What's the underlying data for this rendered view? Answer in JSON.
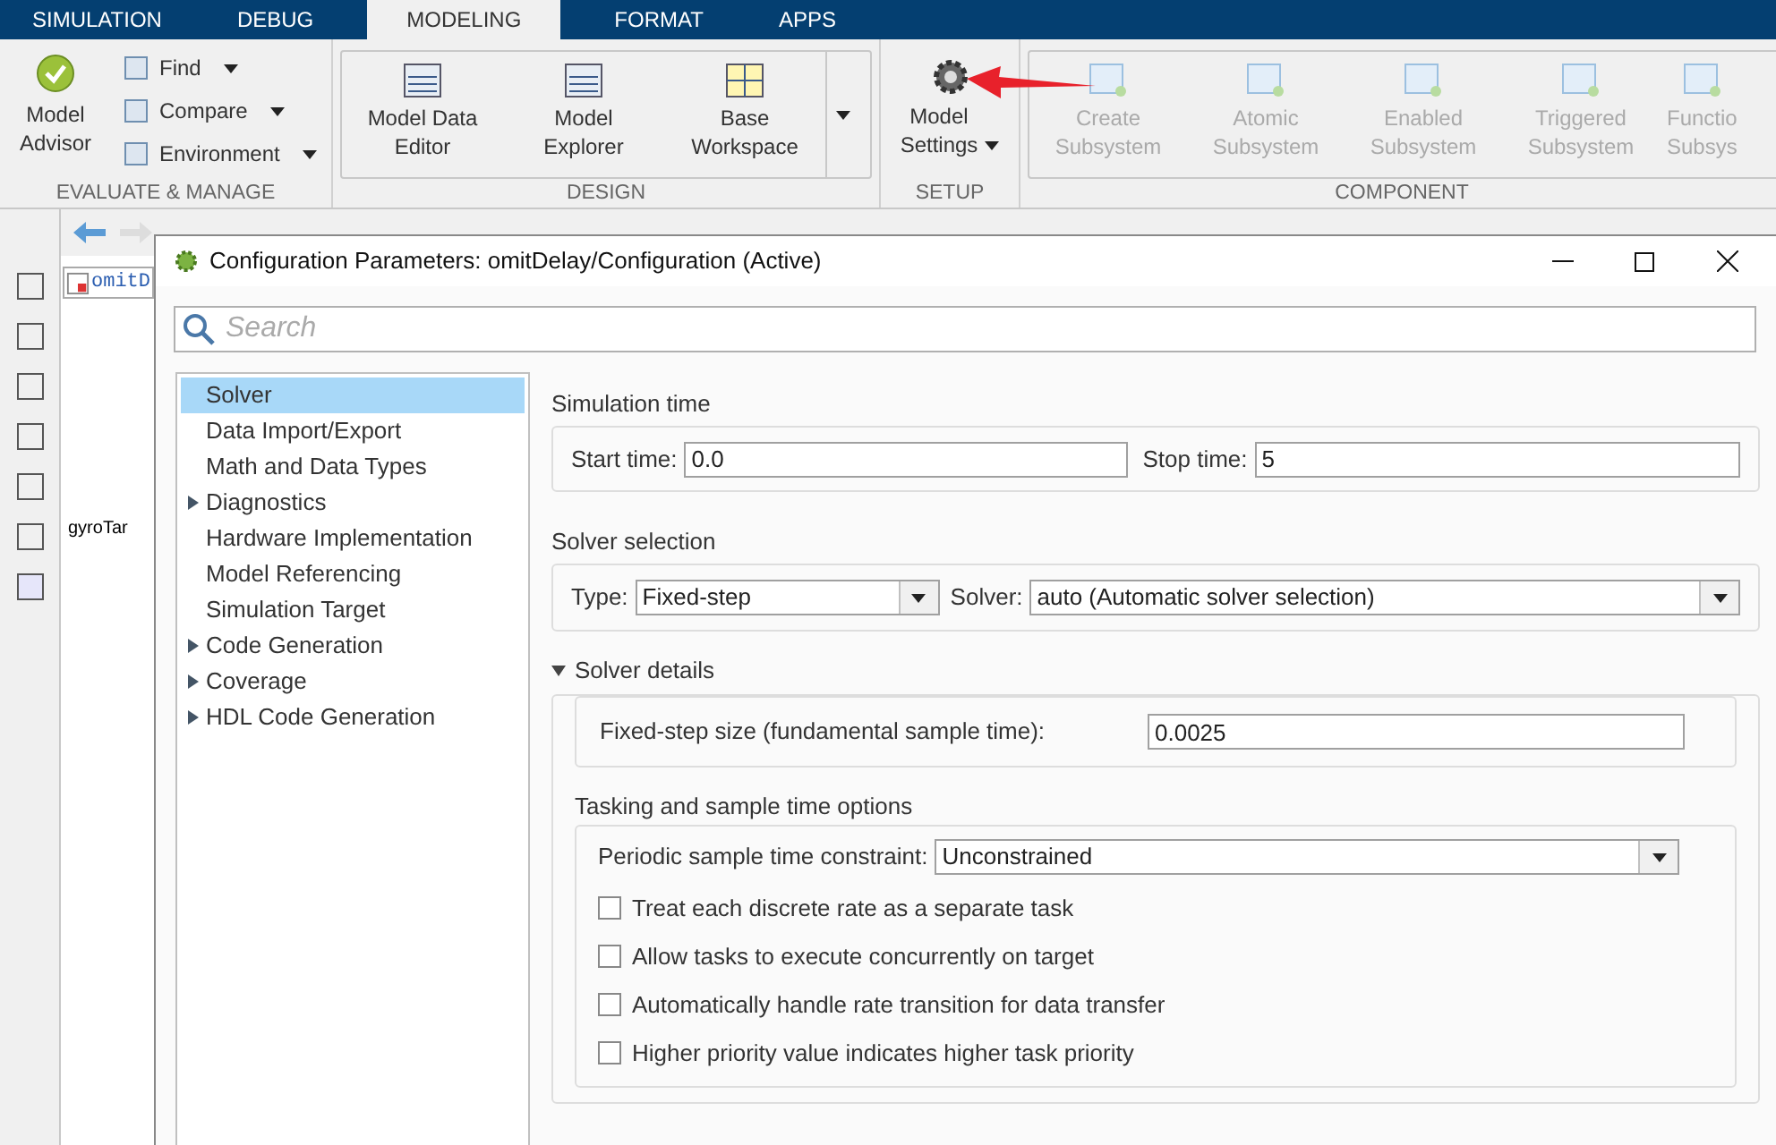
{
  "ribbon_tabs": [
    {
      "label": "SIMULATION",
      "selected": false
    },
    {
      "label": "DEBUG",
      "selected": false
    },
    {
      "label": "MODELING",
      "selected": true
    },
    {
      "label": "FORMAT",
      "selected": false
    },
    {
      "label": "APPS",
      "selected": false
    }
  ],
  "evaluate_group": {
    "label": "EVALUATE & MANAGE",
    "advisor": "Model\nAdvisor",
    "small_buttons": [
      "Find",
      "Compare",
      "Environment"
    ]
  },
  "design_group": {
    "label": "DESIGN",
    "buttons": [
      "Model Data\nEditor",
      "Model\nExplorer",
      "Base\nWorkspace"
    ]
  },
  "setup_group": {
    "label": "SETUP",
    "button": "Model\nSettings"
  },
  "component_group": {
    "label": "COMPONENT",
    "buttons": [
      {
        "label": "Create\nSubsystem",
        "disabled": true
      },
      {
        "label": "Atomic\nSubsystem",
        "disabled": true
      },
      {
        "label": "Enabled\nSubsystem",
        "disabled": true
      },
      {
        "label": "Triggered\nSubsystem",
        "disabled": true
      },
      {
        "label": "Functio\nSubsys",
        "disabled": true
      }
    ]
  },
  "editor": {
    "breadcrumb": "omitD",
    "signal_label": "gyroTar"
  },
  "dialog": {
    "title": "Configuration Parameters: omitDelay/Configuration (Active)",
    "search": {
      "placeholder": "Search"
    },
    "tree": [
      {
        "label": "Solver",
        "selected": true,
        "expandable": false
      },
      {
        "label": "Data Import/Export",
        "selected": false,
        "expandable": false
      },
      {
        "label": "Math and Data Types",
        "selected": false,
        "expandable": false
      },
      {
        "label": "Diagnostics",
        "selected": false,
        "expandable": true
      },
      {
        "label": "Hardware Implementation",
        "selected": false,
        "expandable": false
      },
      {
        "label": "Model Referencing",
        "selected": false,
        "expandable": false
      },
      {
        "label": "Simulation Target",
        "selected": false,
        "expandable": false
      },
      {
        "label": "Code Generation",
        "selected": false,
        "expandable": true
      },
      {
        "label": "Coverage",
        "selected": false,
        "expandable": true
      },
      {
        "label": "HDL Code Generation",
        "selected": false,
        "expandable": true
      }
    ],
    "simulation_time": {
      "heading": "Simulation time",
      "start_label": "Start time:",
      "start_value": "0.0",
      "stop_label": "Stop time:",
      "stop_value": "5"
    },
    "solver_selection": {
      "heading": "Solver selection",
      "type_label": "Type:",
      "type_value": "Fixed-step",
      "solver_label": "Solver:",
      "solver_value": "auto (Automatic solver selection)"
    },
    "solver_details": {
      "heading": "Solver details",
      "expanded": true,
      "step_label": "Fixed-step size (fundamental sample time):",
      "step_value": "0.0025",
      "tasking_heading": "Tasking and sample time options",
      "constraint_label": "Periodic sample time constraint:",
      "constraint_value": "Unconstrained",
      "options": [
        {
          "label": "Treat each discrete rate as a separate task",
          "checked": false
        },
        {
          "label": "Allow tasks to execute concurrently on target",
          "checked": false
        },
        {
          "label": "Automatically handle rate transition for data transfer",
          "checked": false
        },
        {
          "label": "Higher priority value indicates higher task priority",
          "checked": false
        }
      ]
    }
  }
}
